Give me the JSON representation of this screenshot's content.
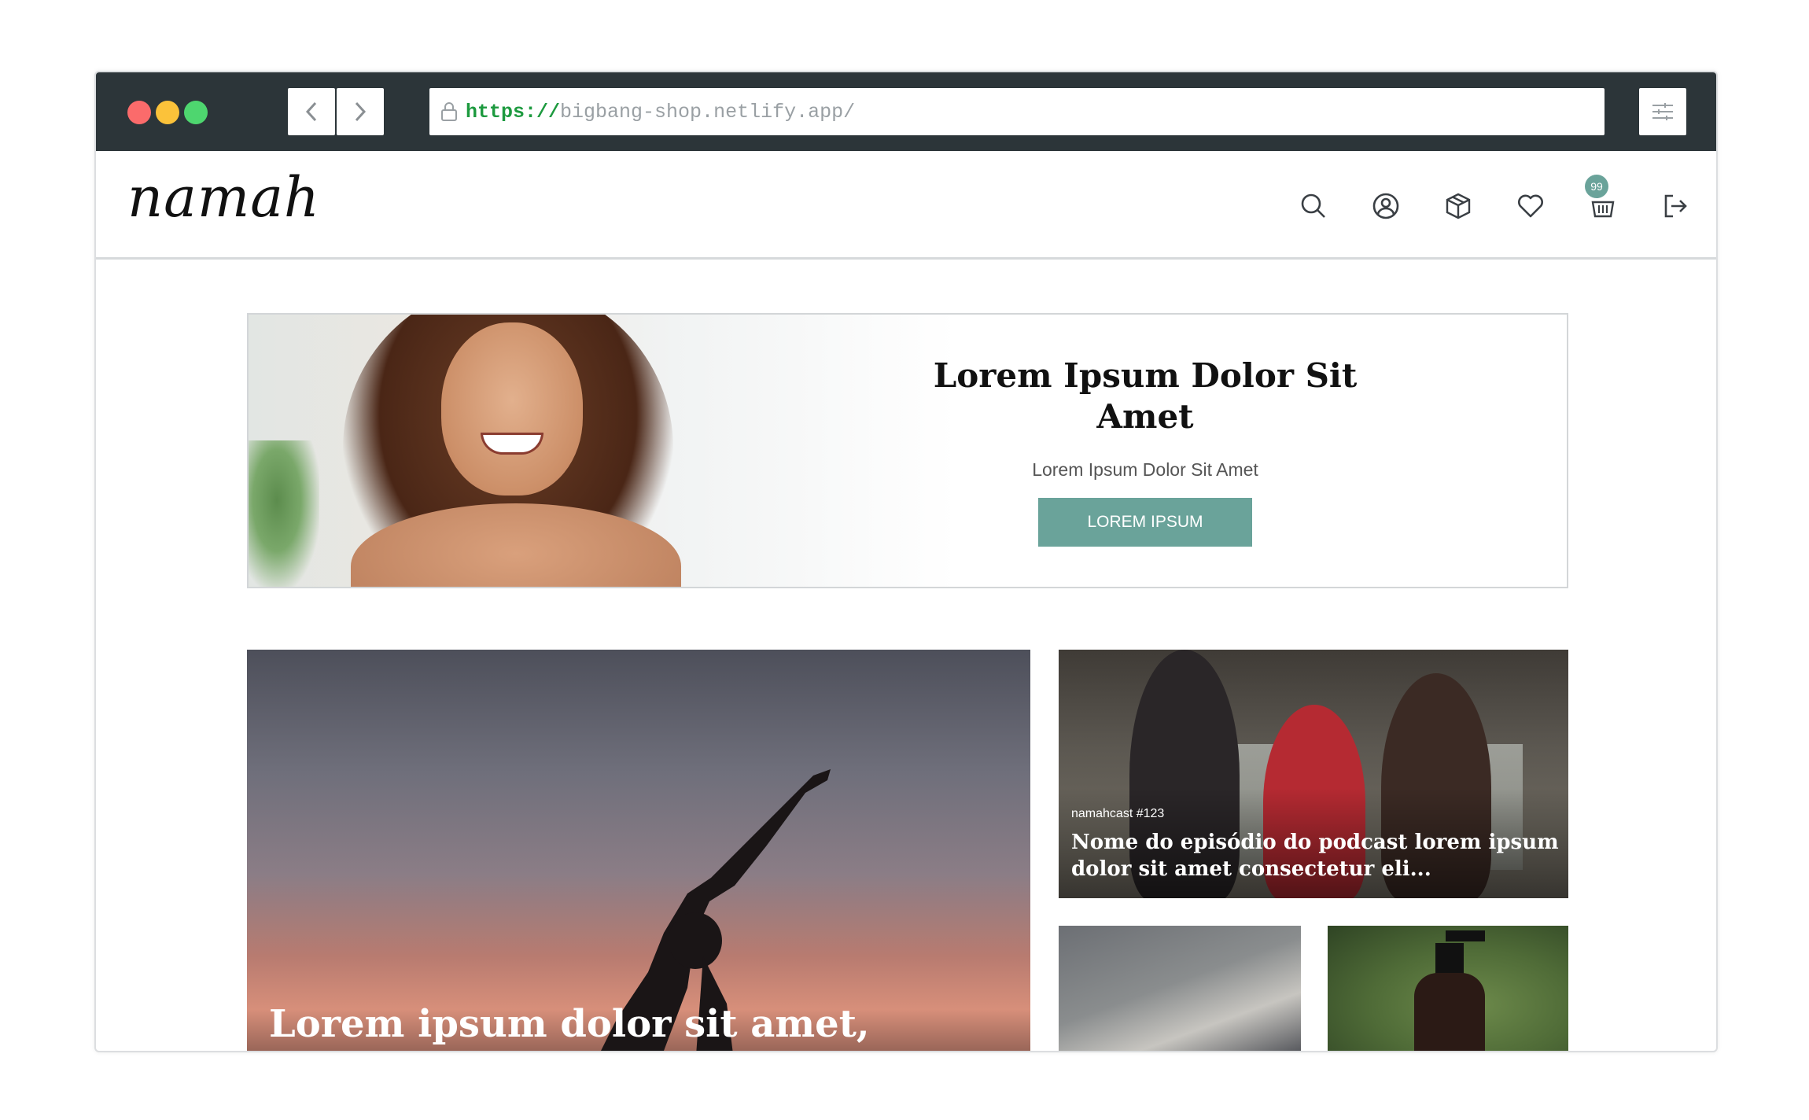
{
  "browser": {
    "url_protocol": "https://",
    "url_rest": "bigbang-shop.netlify.app/"
  },
  "header": {
    "logo_text": "namah",
    "cart_count": "99",
    "icons": [
      "search-icon",
      "user-icon",
      "package-icon",
      "heart-icon",
      "cart-icon",
      "logout-icon"
    ]
  },
  "hero": {
    "title": "Lorem Ipsum Dolor Sit Amet",
    "subtitle": "Lorem Ipsum Dolor Sit Amet",
    "button_label": "LOREM IPSUM"
  },
  "featured": {
    "title": "Lorem ipsum dolor sit amet,"
  },
  "podcast": {
    "tag": "namahcast #123",
    "title": "Nome do episódio do podcast lorem ipsum dolor sit amet consectetur eli..."
  },
  "colors": {
    "accent": "#6aa39a",
    "chrome": "#2c3539"
  }
}
